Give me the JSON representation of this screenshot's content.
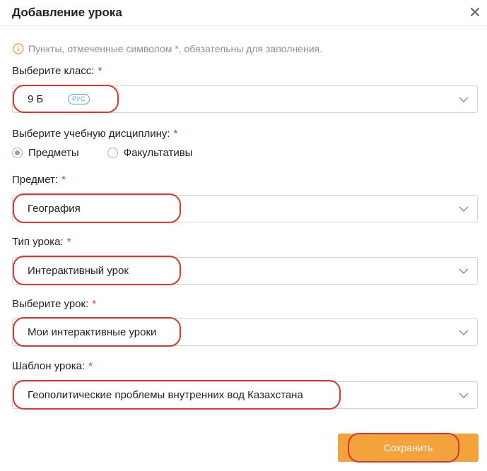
{
  "modal": {
    "title": "Добавление урока",
    "notice": "Пункты, отмеченные символом *, обязательны для заполнения."
  },
  "fields": {
    "class": {
      "label": "Выберите класс:",
      "required_mark": "*",
      "value": "9 Б",
      "badge": "РУС"
    },
    "discipline": {
      "label": "Выберите учебную дисциплину:",
      "required_mark": "*",
      "options": [
        {
          "label": "Предметы",
          "checked": true
        },
        {
          "label": "Факультативы",
          "checked": false
        }
      ]
    },
    "subject": {
      "label": "Предмет:",
      "required_mark": "*",
      "value": "География"
    },
    "lesson_type": {
      "label": "Тип урока:",
      "required_mark": "*",
      "value": "Интерактивный урок"
    },
    "lesson": {
      "label": "Выберите урок:",
      "required_mark": "*",
      "value": "Мои интерактивные уроки"
    },
    "template": {
      "label": "Шаблон урока:",
      "required_mark": "*",
      "value": "Геополитические проблемы внутренних вод Казахстана"
    }
  },
  "actions": {
    "save_label": "Сохранить"
  },
  "colors": {
    "accent": "#f2a33c",
    "required": "#e0315b",
    "highlight": "#e2342b",
    "badge": "#4fb3d9"
  }
}
